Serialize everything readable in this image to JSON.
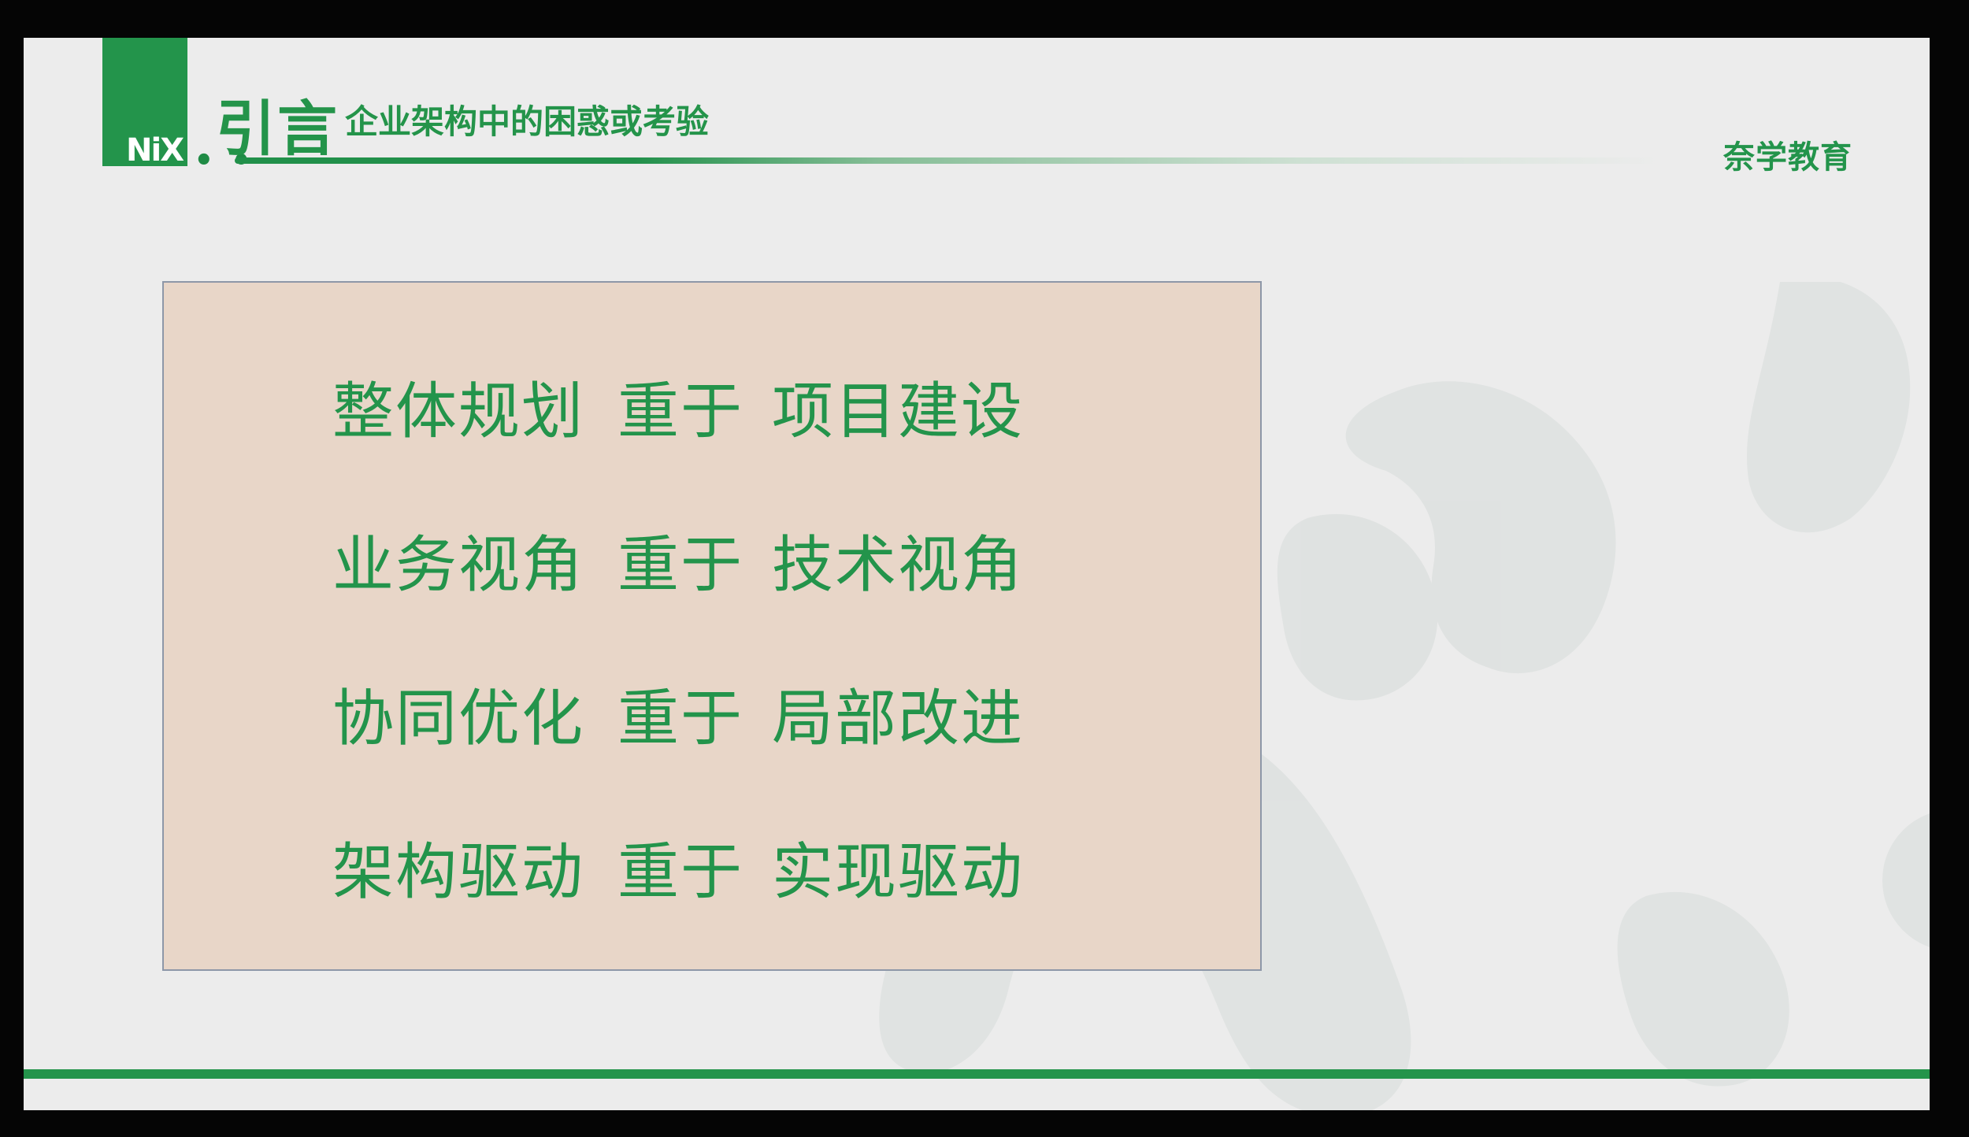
{
  "slide": {
    "logo_text": "NiX",
    "logo_dots": "• •",
    "section_title": "引言",
    "section_subtitle": "企业架构中的困惑或考验",
    "brand": "奈学教育"
  },
  "principles": [
    {
      "left": "整体规划",
      "mid": "重于",
      "right": "项目建设"
    },
    {
      "left": "业务视角",
      "mid": "重于",
      "right": "技术视角"
    },
    {
      "left": "协同优化",
      "mid": "重于",
      "right": "局部改进"
    },
    {
      "left": "架构驱动",
      "mid": "重于",
      "right": "实现驱动"
    }
  ],
  "colors": {
    "accent": "#23944b",
    "slide_background": "#ececec",
    "content_box_background": "#e8d6c8"
  }
}
